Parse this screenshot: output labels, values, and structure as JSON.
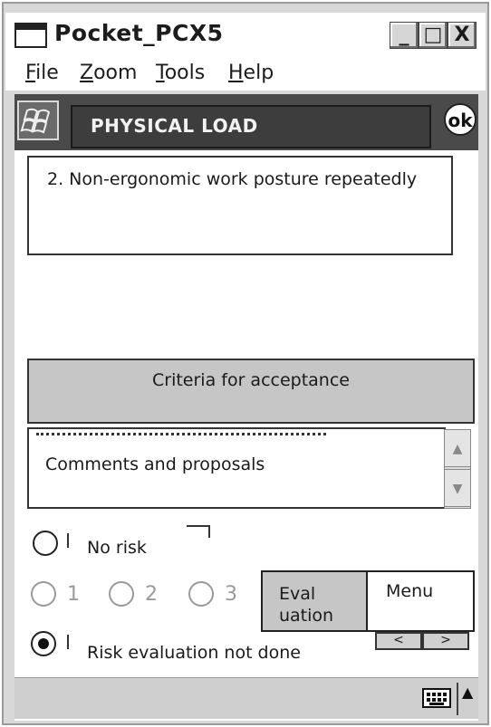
{
  "window": {
    "title": "Pocket_PCX5",
    "controls": {
      "minimize": "_",
      "maximize": "□",
      "close": "X"
    }
  },
  "menubar": {
    "file": {
      "accel": "F",
      "rest": "ile"
    },
    "zoom": {
      "accel": "Z",
      "rest": "oom"
    },
    "tools": {
      "accel": "T",
      "rest": "ools"
    },
    "help": {
      "accel": "H",
      "rest": "elp"
    }
  },
  "header": {
    "title": "PHYSICAL LOAD",
    "ok_label": "ok"
  },
  "question": {
    "text": "2. Non-ergonomic work posture repeatedly"
  },
  "criteria_button": {
    "label": "Criteria for acceptance"
  },
  "comments": {
    "label": "Comments and proposals"
  },
  "risk_options": {
    "no_risk": "No risk",
    "levels": [
      "1",
      "2",
      "3"
    ],
    "not_done": "Risk evaluation not done",
    "selected": "Risk evaluation not done"
  },
  "buttons": {
    "evaluation": "Eval uation",
    "menu": "Menu",
    "prev": "<",
    "next": ">"
  },
  "icons": [
    "windows-start-icon",
    "ok-icon",
    "keyboard-icon",
    "chevron-up-icon",
    "scroll-up-icon",
    "scroll-down-icon"
  ]
}
